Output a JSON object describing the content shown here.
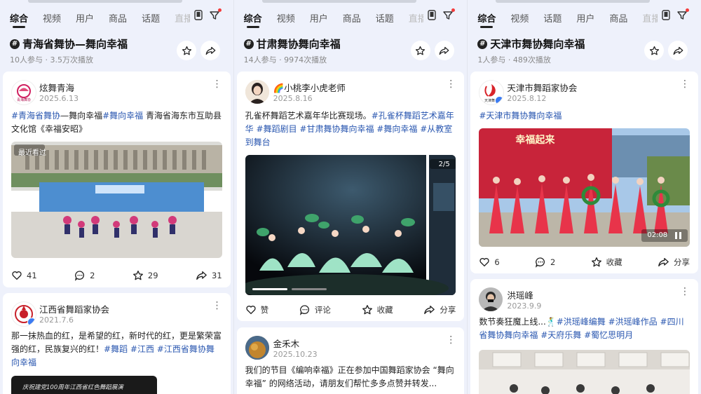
{
  "tabs": [
    "综合",
    "视频",
    "用户",
    "商品",
    "话题",
    "直播"
  ],
  "tabs_c3": [
    "综合",
    "视频",
    "话题",
    "用户",
    "商品",
    "直播"
  ],
  "col1": {
    "topic": {
      "title": "青海省舞协—舞向幸福",
      "meta": "10人参与 · 3.5万次播放"
    },
    "card1": {
      "user": "炫舞青海",
      "date": "2025.6.13",
      "text_parts": [
        "#青海省舞协",
        "—舞向幸福",
        "#舞向幸福",
        " 青海省海东市互助县文化馆《幸福安昭》"
      ],
      "media_label": "最近看过",
      "counts": {
        "like": "41",
        "comment": "2",
        "star": "29",
        "share": "31"
      }
    },
    "card2": {
      "user": "江西省舞蹈家协会",
      "date": "2021.7.6",
      "text_parts": [
        "那一抹热血的红，是希望的红，新时代的红，更是繁荣富强的红，民族复兴的红！",
        "#舞蹈",
        " ",
        "#江西",
        " ",
        "#江西省舞协舞向幸福"
      ],
      "banner": "庆祝建党100周年江西省红色舞蹈展演"
    }
  },
  "col2": {
    "topic": {
      "title": "甘肃舞协舞向幸福",
      "meta": "14人参与 · 9974次播放"
    },
    "card1": {
      "user": "🌈小桃李小虎老师",
      "date": "2025.8.16",
      "text_parts": [
        "孔雀杯舞蹈艺术嘉年华比赛现场。",
        "#孔雀杯舞蹈艺术嘉年华",
        " ",
        "#舞蹈剧目",
        " ",
        "#甘肃舞协舞向幸福",
        " ",
        "#舞向幸福",
        " ",
        "#从教室到舞台"
      ],
      "media_counter": "2/5",
      "actions": {
        "like": "赞",
        "comment": "评论",
        "star": "收藏",
        "share": "分享"
      }
    },
    "card2": {
      "user": "金禾木",
      "date": "2025.10.23",
      "text": "我们的节目《编响幸福》正在参加中国舞蹈家协会 “舞向幸福” 的网络活动，请朋友们帮忙多多点赞并转发..."
    }
  },
  "col3": {
    "topic": {
      "title": "天津市舞协舞向幸福",
      "meta": "1人参与 · 489次播放"
    },
    "card1": {
      "user": "天津市舞蹈家协会",
      "date": "2025.8.12",
      "text_parts": [
        "#天津市舞协舞向幸福"
      ],
      "banner": "幸福起来",
      "duration": "02:08",
      "counts": {
        "like": "6",
        "comment": "2",
        "star": "收藏",
        "share": "分享"
      }
    },
    "card2": {
      "user": "洪瑶峰",
      "date": "2023.9.9",
      "text_parts": [
        "数节奏狂魔上线...🕺",
        "#洪瑶峰编舞",
        " ",
        "#洪瑶峰作品",
        " ",
        "#四川省舞协舞向幸福",
        " ",
        "#天府乐舞",
        " ",
        "#蜀忆思明月"
      ]
    }
  },
  "colors": {
    "tag": "#2a57b0",
    "bg": "#eef1fb",
    "red_dot": "#f43b3b"
  }
}
